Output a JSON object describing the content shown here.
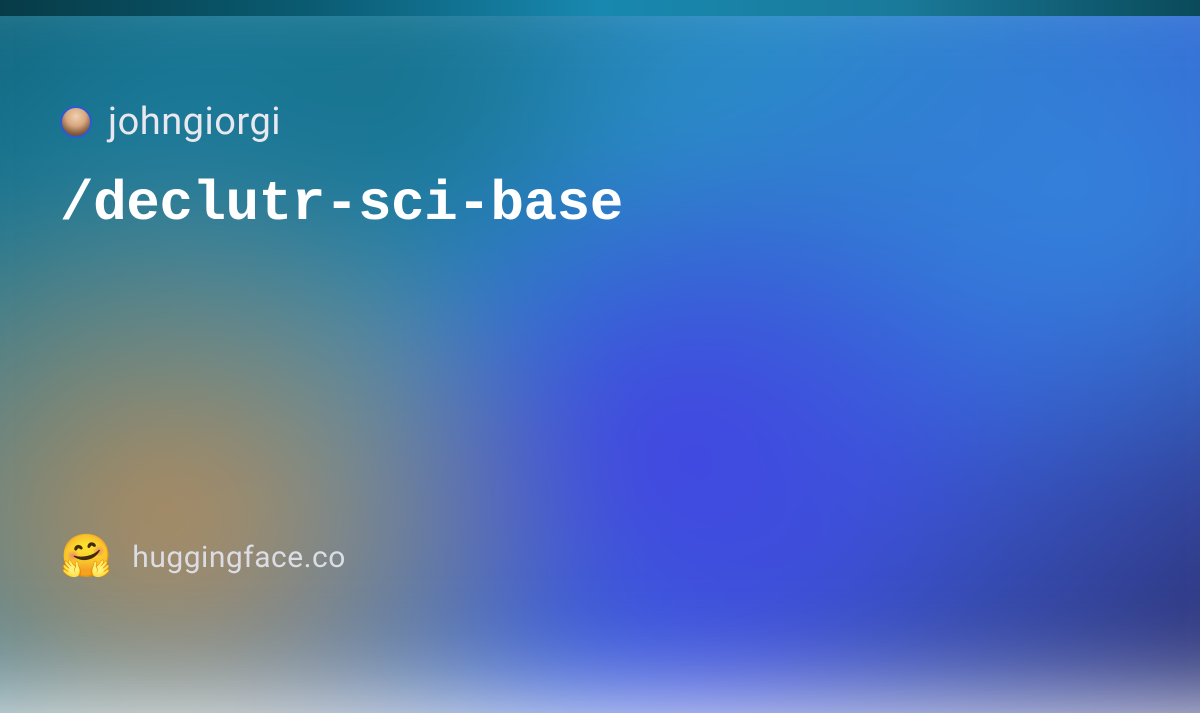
{
  "card": {
    "username": "johngiorgi",
    "model_path": "/declutr-sci-base",
    "logo_emoji": "🤗",
    "domain": "huggingface.co"
  }
}
